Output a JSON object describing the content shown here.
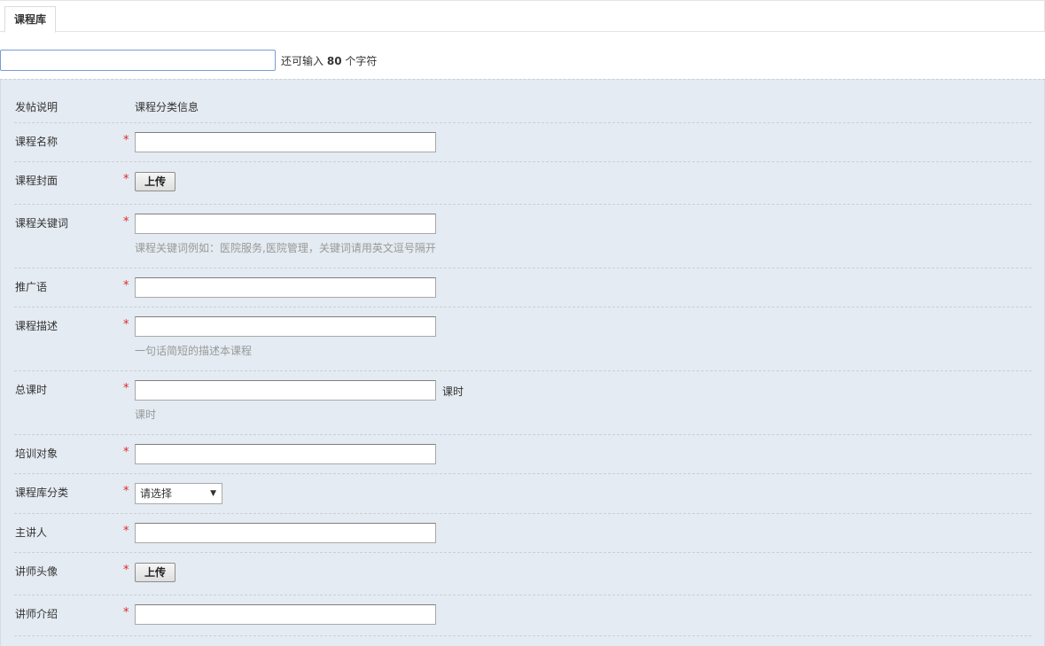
{
  "tabs": [
    {
      "label": "课程库"
    }
  ],
  "title_field": {
    "value": "",
    "hint_prefix": "还可输入",
    "remaining": "80",
    "hint_suffix": "个字符"
  },
  "form": {
    "posting_note": {
      "label": "发帖说明",
      "value": "课程分类信息"
    },
    "course_name": {
      "label": "课程名称",
      "required": "*",
      "value": ""
    },
    "course_cover": {
      "label": "课程封面",
      "required": "*",
      "button": "上传"
    },
    "course_keywords": {
      "label": "课程关键词",
      "required": "*",
      "value": "",
      "hint": "课程关键词例如：医院服务,医院管理，关键词请用英文逗号隔开"
    },
    "promo_text": {
      "label": "推广语",
      "required": "*",
      "value": ""
    },
    "course_desc": {
      "label": "课程描述",
      "required": "*",
      "value": "",
      "hint": "一句话简短的描述本课程"
    },
    "total_hours": {
      "label": "总课时",
      "required": "*",
      "value": "",
      "unit": "课时",
      "hint": "课时"
    },
    "target_audience": {
      "label": "培训对象",
      "required": "*",
      "value": ""
    },
    "category": {
      "label": "课程库分类",
      "required": "*",
      "selected": "请选择"
    },
    "lecturer": {
      "label": "主讲人",
      "required": "*",
      "value": ""
    },
    "lecturer_avatar": {
      "label": "讲师头像",
      "required": "*",
      "button": "上传"
    },
    "lecturer_intro": {
      "label": "讲师介绍",
      "required": "*",
      "value": ""
    }
  },
  "colors": {
    "required": "#e0262b",
    "panel_bg": "#e4ebf2",
    "hint": "#999999",
    "focus_border": "#7a9cd3"
  }
}
